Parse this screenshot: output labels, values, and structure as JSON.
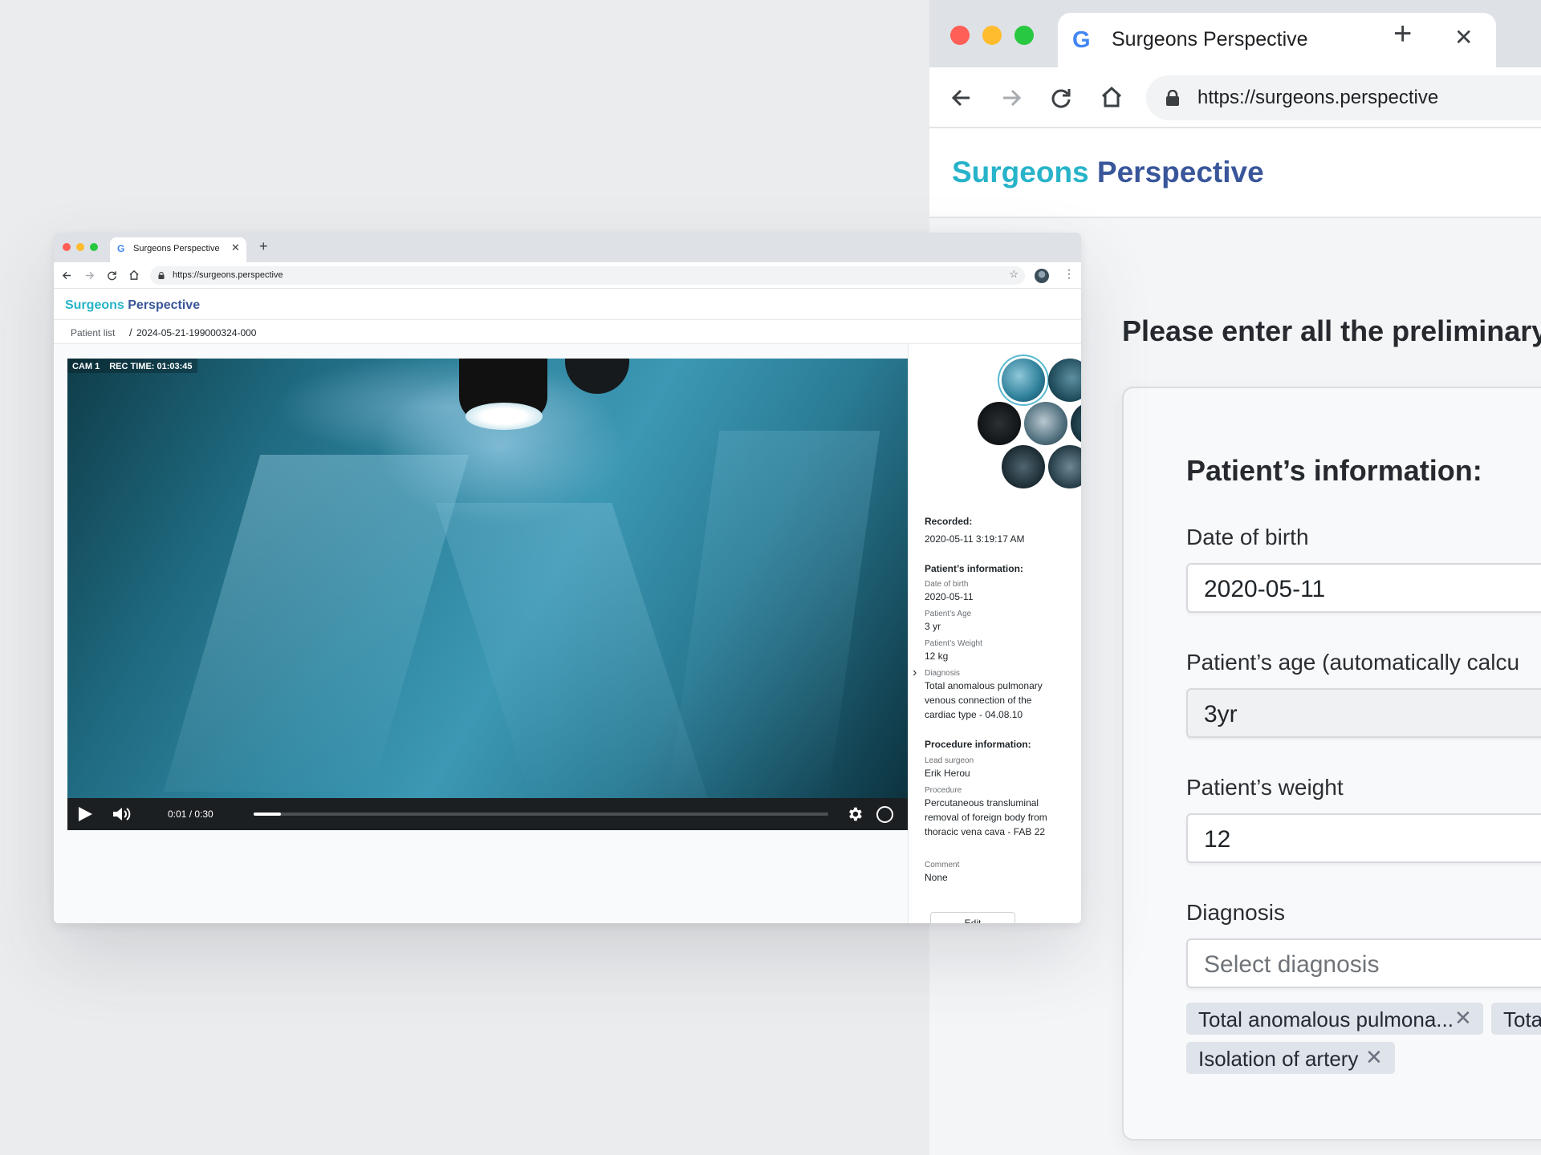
{
  "back_window": {
    "tab_title": "Surgeons Perspective",
    "tab_close": "✕",
    "new_tab": "+",
    "url": "https://surgeons.perspective",
    "brand_part1": "Surgeons",
    "brand_part2": "Perspective",
    "prompt": "Please enter all the preliminary",
    "form": {
      "heading": "Patient’s information:",
      "dob_label": "Date of birth",
      "dob_value": "2020-05-11",
      "age_label": "Patient’s age (automatically calcu",
      "age_value": "3yr",
      "weight_label": "Patient’s weight",
      "weight_value": "12",
      "diagnosis_label": "Diagnosis",
      "diagnosis_placeholder": "Select diagnosis",
      "chips": [
        "Total anomalous pulmona...",
        "Tota",
        "Isolation of artery"
      ],
      "chip_remove": "✕"
    },
    "colors": {
      "traffic_red": "#ff5f57",
      "traffic_yellow": "#febc2e",
      "traffic_green": "#28c840"
    }
  },
  "front_window": {
    "tab_title": "Surgeons Perspective",
    "tab_close": "✕",
    "new_tab": "+",
    "url": "https://surgeons.perspective",
    "star_icon": "☆",
    "kebab_icon": "⋮",
    "brand_part1": "Surgeons",
    "brand_part2": "Perspective",
    "breadcrumb": {
      "link": "Patient list",
      "separator": "/",
      "current": "2024-05-21-199000324-000"
    },
    "video": {
      "cam_label": "CAM 1",
      "rec_time": "REC TIME: 01:03:45",
      "time": "0:01 / 0:30",
      "progress_fraction": 0.048
    },
    "collapse_icon": "›",
    "sidebar": {
      "recorded_label": "Recorded:",
      "recorded_value": "2020-05-11  3:19:17 AM",
      "patient_heading": "Patient’s information:",
      "dob_label": "Date of birth",
      "dob_value": "2020-05-11",
      "age_label": "Patient’s Age",
      "age_value": "3 yr",
      "weight_label": "Patient’s Weight",
      "weight_value": "12 kg",
      "diagnosis_label": "Diagnosis",
      "diagnosis_value": "Total anomalous pulmonary venous connection of the cardiac type - 04.08.10",
      "procedure_heading": "Procedure information:",
      "surgeon_label": "Lead surgeon",
      "surgeon_value": "Erik Herou",
      "procedure_label": "Procedure",
      "procedure_value": "Percutaneous transluminal removal of foreign body from thoracic vena cava - FAB 22",
      "comment_label": "Comment",
      "comment_value": "None",
      "edit_label": "Edit"
    }
  }
}
